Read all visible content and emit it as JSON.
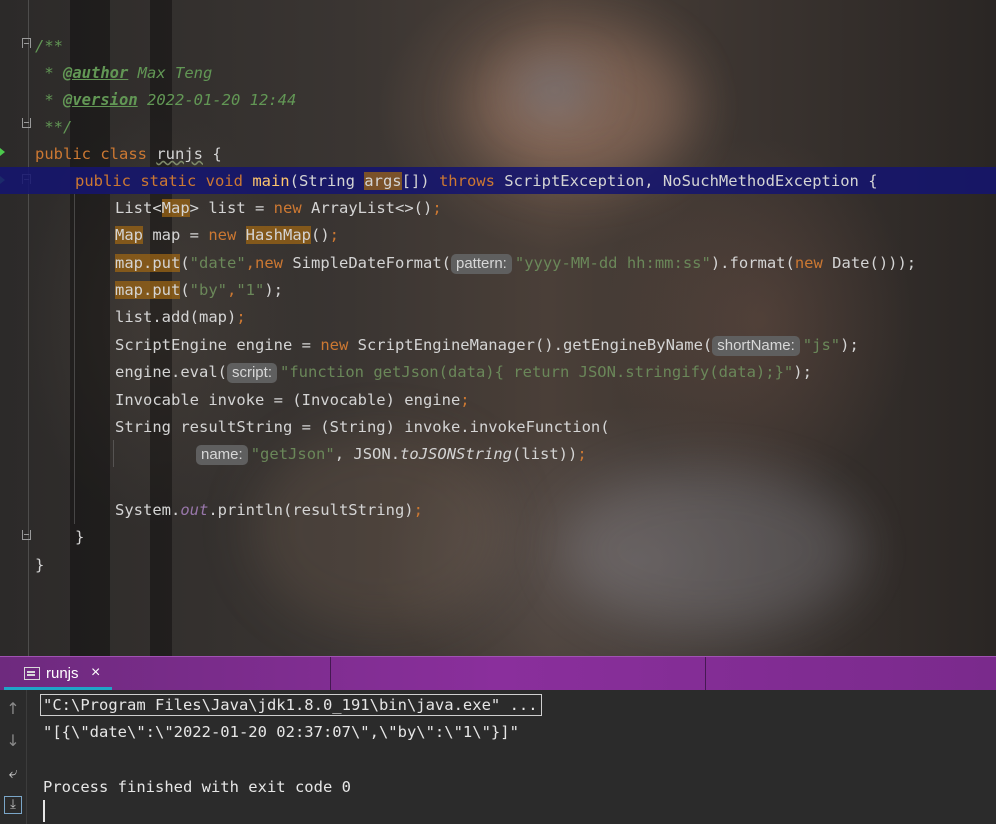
{
  "editor": {
    "lines": [
      {
        "id": "l1",
        "text": "/**"
      },
      {
        "id": "l2",
        "star": " * ",
        "tag": "@author",
        "value": " Max Teng"
      },
      {
        "id": "l3",
        "star": " * ",
        "tag": "@version",
        "value": " 2022-01-20 12:44"
      },
      {
        "id": "l4",
        "text": " **/"
      },
      {
        "id": "l5",
        "kw": "public class ",
        "name": "runjs",
        "rest": " {"
      },
      {
        "id": "l6",
        "kw1": "public static void ",
        "fn": "main",
        "p1": "(String ",
        "args": "args",
        "p2": "[]) ",
        "kw2": "throws ",
        "rest": "ScriptException, NoSuchMethodException {"
      },
      {
        "id": "l7",
        "a": "List<",
        "b": "Map",
        "c": "> list = ",
        "kw": "new ",
        "d": "ArrayList<>()",
        "e": ";"
      },
      {
        "id": "l8",
        "a": "Map",
        "b": " map = ",
        "kw": "new ",
        "c": "HashMap",
        "d": "()",
        "e": ";"
      },
      {
        "id": "l9",
        "a": "map.put",
        "b": "(",
        "s1": "\"date\"",
        "c": ",",
        "kw": "new ",
        "d": "SimpleDateFormat(",
        "hint": "pattern:",
        "s2": "\"yyyy-MM-dd hh:mm:ss\"",
        "e": ").format(",
        "kw2": "new ",
        "f": "Date()));"
      },
      {
        "id": "l10",
        "a": "map.put",
        "b": "(",
        "s1": "\"by\"",
        "c": ",",
        "s2": "\"1\"",
        "d": ");"
      },
      {
        "id": "l11",
        "a": "list.add(map)",
        "b": ";"
      },
      {
        "id": "l12",
        "a": "ScriptEngine engine = ",
        "kw": "new ",
        "b": "ScriptEngineManager().getEngineByName(",
        "hint": "shortName:",
        "s": "\"js\"",
        "c": ");"
      },
      {
        "id": "l13",
        "a": "engine.eval(",
        "hint": "script:",
        "s": "\"function getJson(data){ return JSON.stringify(data);}\"",
        "b": ");"
      },
      {
        "id": "l14",
        "a": "Invocable invoke = (Invocable) engine",
        "b": ";"
      },
      {
        "id": "l15",
        "a": "String resultString = (String) invoke.invokeFunction("
      },
      {
        "id": "l16",
        "hint": "name:",
        "s": "\"getJson\"",
        "a": ", JSON.",
        "b": "toJSONString",
        "c": "(list))",
        "d": ";"
      },
      {
        "id": "l18",
        "a": "System.",
        "b": "out",
        "c": ".println(resultString)",
        "d": ";"
      },
      {
        "id": "l19",
        "text": "}"
      },
      {
        "id": "l20",
        "text": "}"
      }
    ]
  },
  "run_panel": {
    "tab_label": "runjs",
    "tab_close": "×",
    "output": [
      "\"C:\\Program Files\\Java\\jdk1.8.0_191\\bin\\java.exe\" ...",
      "\"[{\\\"date\\\":\\\"2022-01-20 02:37:07\\\",\\\"by\\\":\\\"1\\\"}]\"",
      "Process finished with exit code 0"
    ],
    "side_icons": [
      "arrow-up-icon",
      "arrow-down-icon",
      "soft-wrap-icon",
      "scroll-to-end-icon"
    ]
  }
}
